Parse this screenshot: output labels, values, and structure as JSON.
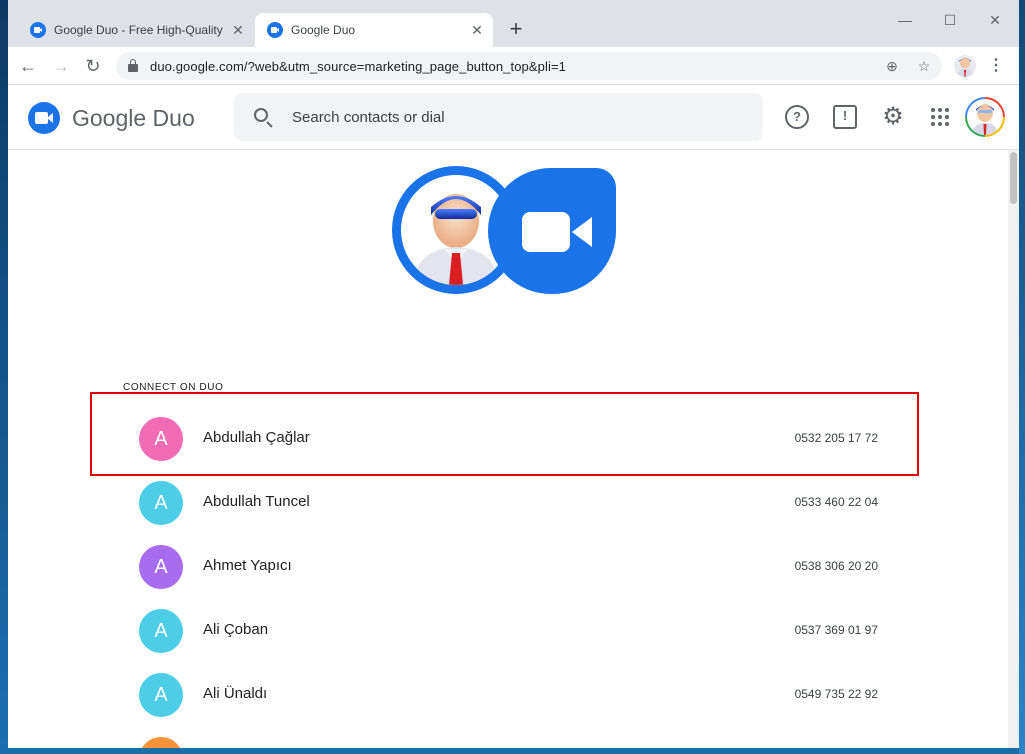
{
  "browser": {
    "tabs": [
      {
        "title": "Google Duo - Free High-Quality Vide",
        "close": "✕"
      },
      {
        "title": "Google Duo",
        "close": "✕"
      }
    ],
    "new_tab": "+",
    "window_controls": {
      "minimize": "—",
      "maximize": "☐",
      "close": "✕"
    },
    "url": "duo.google.com/?web&utm_source=marketing_page_button_top&pli=1"
  },
  "app": {
    "brand": "Google Duo",
    "search": {
      "placeholder": "Search contacts or dial"
    },
    "header_icons": [
      "help-icon",
      "feedback-icon",
      "gear-icon",
      "apps-grid-icon",
      "account-avatar"
    ],
    "section_label": "CONNECT ON DUO",
    "contacts": [
      {
        "initial": "A",
        "name": "Abdullah Çağlar",
        "phone": "0532 205 17 72",
        "color": "#f26bb5"
      },
      {
        "initial": "A",
        "name": "Abdullah Tuncel",
        "phone": "0533 460 22 04",
        "color": "#4ecde6"
      },
      {
        "initial": "A",
        "name": "Ahmet Yapıcı",
        "phone": "0538 306 20 20",
        "color": "#a86cf0"
      },
      {
        "initial": "A",
        "name": "Ali Çoban",
        "phone": "0537 369 01 97",
        "color": "#4ecde6"
      },
      {
        "initial": "A",
        "name": "Ali Ünaldı",
        "phone": "0549 735 22 92",
        "color": "#4ecde6"
      }
    ],
    "partial_contact_color": "#f5933a"
  },
  "colors": {
    "accent": "#1a73e8",
    "highlight_border": "#e00000"
  }
}
